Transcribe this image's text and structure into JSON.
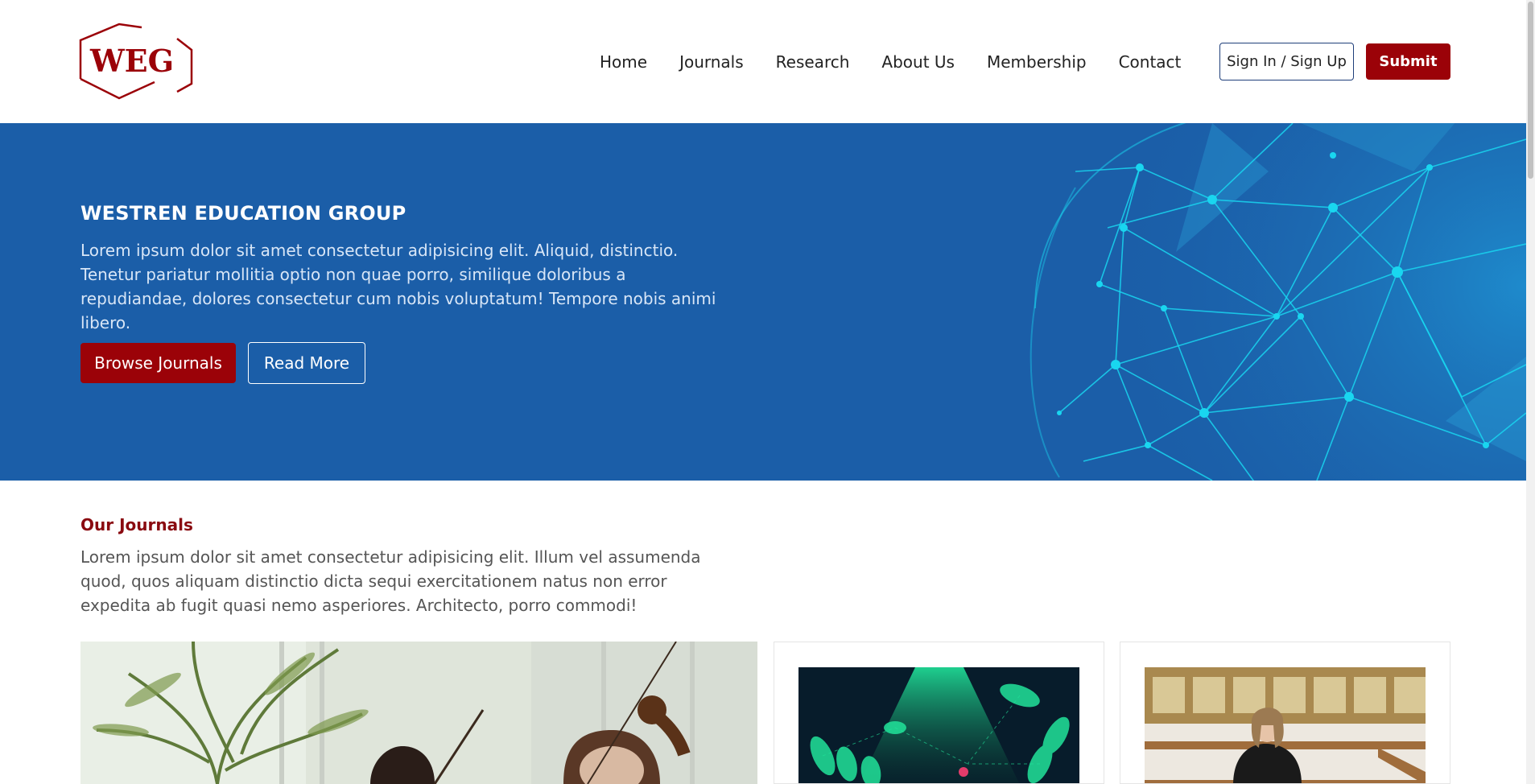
{
  "header": {
    "logo_text": "WEG",
    "nav": [
      "Home",
      "Journals",
      "Research",
      "About Us",
      "Membership",
      "Contact"
    ],
    "signin_label": "Sign In / Sign Up",
    "submit_label": "Submit"
  },
  "hero": {
    "title": "WESTREN EDUCATION GROUP",
    "text": "Lorem ipsum dolor sit amet consectetur adipisicing elit. Aliquid, distinctio. Tenetur pariatur mollitia optio non quae porro, similique doloribus a repudiandae, dolores consectetur cum nobis voluptatum! Tempore nobis animi libero.",
    "browse_label": "Browse Journals",
    "read_label": "Read More"
  },
  "journals": {
    "title": "Our Journals",
    "text": "Lorem ipsum dolor sit amet consectetur adipisicing elit. Illum vel assumenda quod, quos aliquam distinctio dicta sequi exercitationem natus non error expedita ab fugit quasi nemo asperiores. Architecto, porro commodi!"
  },
  "colors": {
    "brand_red": "#9b0208",
    "hero_blue": "#1b5ea8",
    "globe_cyan": "#19d6f0"
  }
}
